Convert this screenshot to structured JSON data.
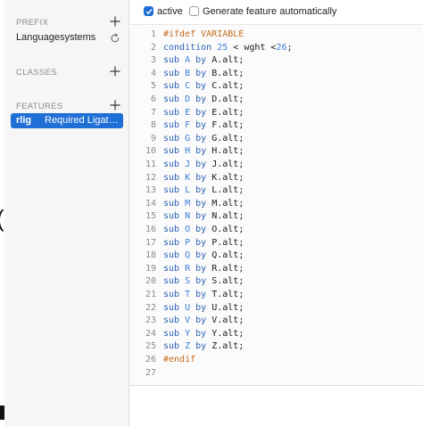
{
  "sidebar": {
    "prefix": {
      "title": "PREFIX",
      "items": [
        {
          "label": "Languagesystems"
        }
      ]
    },
    "classes": {
      "title": "CLASSES",
      "items": []
    },
    "features": {
      "title": "FEATURES",
      "items": [
        {
          "tag": "rlig",
          "name": "Required Ligatu…",
          "selected": true
        }
      ]
    },
    "icons": {
      "add": "plus-icon",
      "refresh": "refresh-icon"
    }
  },
  "toolbar": {
    "active": {
      "label": "active",
      "checked": true
    },
    "generate": {
      "label": "Generate feature automatically",
      "checked": false
    }
  },
  "colors": {
    "accent": "#1f6fd6",
    "keyword": "#2b5fb4",
    "class_token": "#3b7fd6",
    "preprocessor": "#c46a1a"
  },
  "editor": {
    "lines": [
      [
        {
          "t": "#ifdef VARIABLE",
          "k": "pre"
        }
      ],
      [
        {
          "t": "condition",
          "k": "kw"
        },
        {
          "t": " ",
          "k": "plain"
        },
        {
          "t": "25",
          "k": "num"
        },
        {
          "t": " < wght <",
          "k": "plain"
        },
        {
          "t": "26",
          "k": "num"
        },
        {
          "t": ";",
          "k": "plain"
        }
      ],
      [
        {
          "t": "sub",
          "k": "kw"
        },
        {
          "t": " ",
          "k": "plain"
        },
        {
          "t": "A",
          "k": "cls"
        },
        {
          "t": " ",
          "k": "plain"
        },
        {
          "t": "by",
          "k": "kw"
        },
        {
          "t": " A.alt;",
          "k": "plain"
        }
      ],
      [
        {
          "t": "sub",
          "k": "kw"
        },
        {
          "t": " ",
          "k": "plain"
        },
        {
          "t": "B",
          "k": "cls"
        },
        {
          "t": " ",
          "k": "plain"
        },
        {
          "t": "by",
          "k": "kw"
        },
        {
          "t": " B.alt;",
          "k": "plain"
        }
      ],
      [
        {
          "t": "sub",
          "k": "kw"
        },
        {
          "t": " ",
          "k": "plain"
        },
        {
          "t": "C",
          "k": "cls"
        },
        {
          "t": " ",
          "k": "plain"
        },
        {
          "t": "by",
          "k": "kw"
        },
        {
          "t": " C.alt;",
          "k": "plain"
        }
      ],
      [
        {
          "t": "sub",
          "k": "kw"
        },
        {
          "t": " ",
          "k": "plain"
        },
        {
          "t": "D",
          "k": "cls"
        },
        {
          "t": " ",
          "k": "plain"
        },
        {
          "t": "by",
          "k": "kw"
        },
        {
          "t": " D.alt;",
          "k": "plain"
        }
      ],
      [
        {
          "t": "sub",
          "k": "kw"
        },
        {
          "t": " ",
          "k": "plain"
        },
        {
          "t": "E",
          "k": "cls"
        },
        {
          "t": " ",
          "k": "plain"
        },
        {
          "t": "by",
          "k": "kw"
        },
        {
          "t": " E.alt;",
          "k": "plain"
        }
      ],
      [
        {
          "t": "sub",
          "k": "kw"
        },
        {
          "t": " ",
          "k": "plain"
        },
        {
          "t": "F",
          "k": "cls"
        },
        {
          "t": " ",
          "k": "plain"
        },
        {
          "t": "by",
          "k": "kw"
        },
        {
          "t": " F.alt;",
          "k": "plain"
        }
      ],
      [
        {
          "t": "sub",
          "k": "kw"
        },
        {
          "t": " ",
          "k": "plain"
        },
        {
          "t": "G",
          "k": "cls"
        },
        {
          "t": " ",
          "k": "plain"
        },
        {
          "t": "by",
          "k": "kw"
        },
        {
          "t": " G.alt;",
          "k": "plain"
        }
      ],
      [
        {
          "t": "sub",
          "k": "kw"
        },
        {
          "t": " ",
          "k": "plain"
        },
        {
          "t": "H",
          "k": "cls"
        },
        {
          "t": " ",
          "k": "plain"
        },
        {
          "t": "by",
          "k": "kw"
        },
        {
          "t": " H.alt;",
          "k": "plain"
        }
      ],
      [
        {
          "t": "sub",
          "k": "kw"
        },
        {
          "t": " ",
          "k": "plain"
        },
        {
          "t": "J",
          "k": "cls"
        },
        {
          "t": " ",
          "k": "plain"
        },
        {
          "t": "by",
          "k": "kw"
        },
        {
          "t": " J.alt;",
          "k": "plain"
        }
      ],
      [
        {
          "t": "sub",
          "k": "kw"
        },
        {
          "t": " ",
          "k": "plain"
        },
        {
          "t": "K",
          "k": "cls"
        },
        {
          "t": " ",
          "k": "plain"
        },
        {
          "t": "by",
          "k": "kw"
        },
        {
          "t": " K.alt;",
          "k": "plain"
        }
      ],
      [
        {
          "t": "sub",
          "k": "kw"
        },
        {
          "t": " ",
          "k": "plain"
        },
        {
          "t": "L",
          "k": "cls"
        },
        {
          "t": " ",
          "k": "plain"
        },
        {
          "t": "by",
          "k": "kw"
        },
        {
          "t": " L.alt;",
          "k": "plain"
        }
      ],
      [
        {
          "t": "sub",
          "k": "kw"
        },
        {
          "t": " ",
          "k": "plain"
        },
        {
          "t": "M",
          "k": "cls"
        },
        {
          "t": " ",
          "k": "plain"
        },
        {
          "t": "by",
          "k": "kw"
        },
        {
          "t": " M.alt;",
          "k": "plain"
        }
      ],
      [
        {
          "t": "sub",
          "k": "kw"
        },
        {
          "t": " ",
          "k": "plain"
        },
        {
          "t": "N",
          "k": "cls"
        },
        {
          "t": " ",
          "k": "plain"
        },
        {
          "t": "by",
          "k": "kw"
        },
        {
          "t": " N.alt;",
          "k": "plain"
        }
      ],
      [
        {
          "t": "sub",
          "k": "kw"
        },
        {
          "t": " ",
          "k": "plain"
        },
        {
          "t": "O",
          "k": "cls"
        },
        {
          "t": " ",
          "k": "plain"
        },
        {
          "t": "by",
          "k": "kw"
        },
        {
          "t": " O.alt;",
          "k": "plain"
        }
      ],
      [
        {
          "t": "sub",
          "k": "kw"
        },
        {
          "t": " ",
          "k": "plain"
        },
        {
          "t": "P",
          "k": "cls"
        },
        {
          "t": " ",
          "k": "plain"
        },
        {
          "t": "by",
          "k": "kw"
        },
        {
          "t": " P.alt;",
          "k": "plain"
        }
      ],
      [
        {
          "t": "sub",
          "k": "kw"
        },
        {
          "t": " ",
          "k": "plain"
        },
        {
          "t": "Q",
          "k": "cls"
        },
        {
          "t": " ",
          "k": "plain"
        },
        {
          "t": "by",
          "k": "kw"
        },
        {
          "t": " Q.alt;",
          "k": "plain"
        }
      ],
      [
        {
          "t": "sub",
          "k": "kw"
        },
        {
          "t": " ",
          "k": "plain"
        },
        {
          "t": "R",
          "k": "cls"
        },
        {
          "t": " ",
          "k": "plain"
        },
        {
          "t": "by",
          "k": "kw"
        },
        {
          "t": " R.alt;",
          "k": "plain"
        }
      ],
      [
        {
          "t": "sub",
          "k": "kw"
        },
        {
          "t": " ",
          "k": "plain"
        },
        {
          "t": "S",
          "k": "cls"
        },
        {
          "t": " ",
          "k": "plain"
        },
        {
          "t": "by",
          "k": "kw"
        },
        {
          "t": " S.alt;",
          "k": "plain"
        }
      ],
      [
        {
          "t": "sub",
          "k": "kw"
        },
        {
          "t": " ",
          "k": "plain"
        },
        {
          "t": "T",
          "k": "cls"
        },
        {
          "t": " ",
          "k": "plain"
        },
        {
          "t": "by",
          "k": "kw"
        },
        {
          "t": " T.alt;",
          "k": "plain"
        }
      ],
      [
        {
          "t": "sub",
          "k": "kw"
        },
        {
          "t": " ",
          "k": "plain"
        },
        {
          "t": "U",
          "k": "cls"
        },
        {
          "t": " ",
          "k": "plain"
        },
        {
          "t": "by",
          "k": "kw"
        },
        {
          "t": " U.alt;",
          "k": "plain"
        }
      ],
      [
        {
          "t": "sub",
          "k": "kw"
        },
        {
          "t": " ",
          "k": "plain"
        },
        {
          "t": "V",
          "k": "cls"
        },
        {
          "t": " ",
          "k": "plain"
        },
        {
          "t": "by",
          "k": "kw"
        },
        {
          "t": " V.alt;",
          "k": "plain"
        }
      ],
      [
        {
          "t": "sub",
          "k": "kw"
        },
        {
          "t": " ",
          "k": "plain"
        },
        {
          "t": "Y",
          "k": "cls"
        },
        {
          "t": " ",
          "k": "plain"
        },
        {
          "t": "by",
          "k": "kw"
        },
        {
          "t": " Y.alt;",
          "k": "plain"
        }
      ],
      [
        {
          "t": "sub",
          "k": "kw"
        },
        {
          "t": " ",
          "k": "plain"
        },
        {
          "t": "Z",
          "k": "cls"
        },
        {
          "t": " ",
          "k": "plain"
        },
        {
          "t": "by",
          "k": "kw"
        },
        {
          "t": " Z.alt;",
          "k": "plain"
        }
      ],
      [
        {
          "t": "#endif",
          "k": "pre"
        }
      ],
      []
    ]
  }
}
